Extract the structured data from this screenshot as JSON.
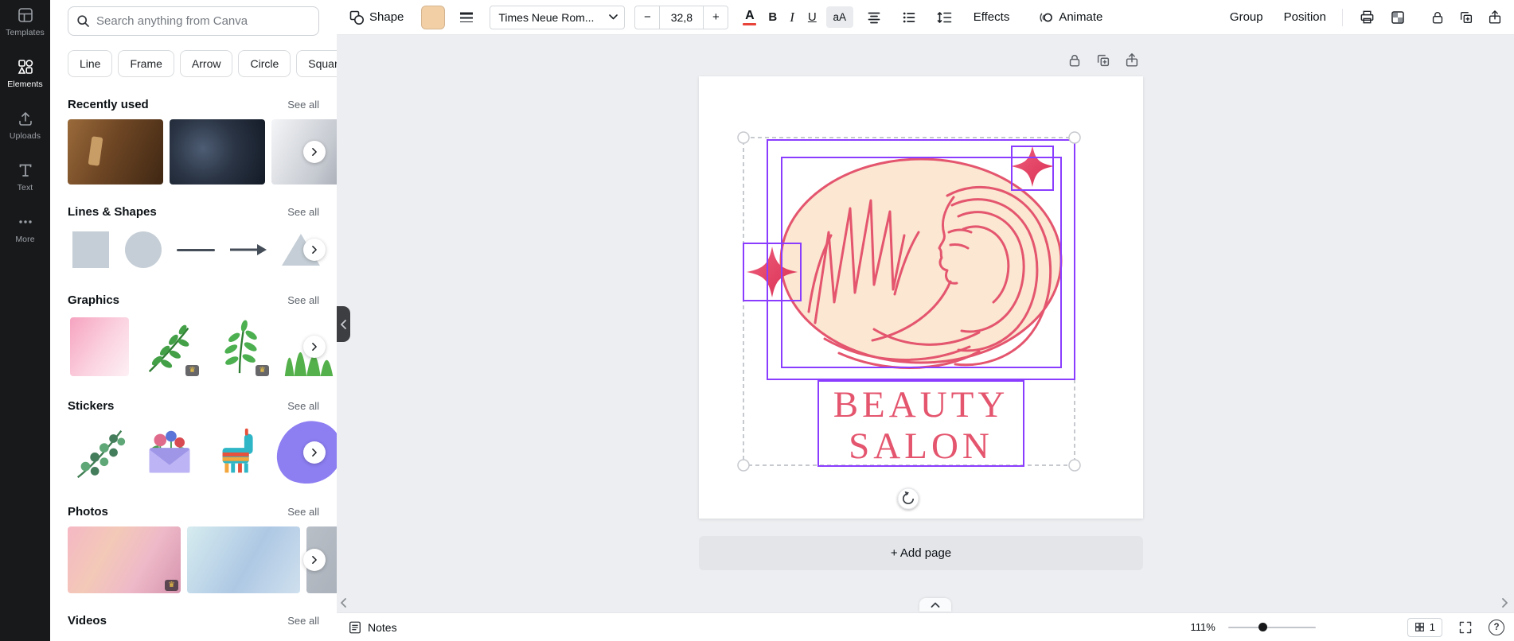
{
  "colors": {
    "purple_selection": "#8b3dff",
    "brand_pink": "#e4556e",
    "sparkle_red": "#d92e52",
    "cream_fill": "#fbe7d2",
    "toolbar_swatch": "#f2cfa5",
    "font_color_indicator": "#e8443a",
    "canvas_background": "#eceef1",
    "rail_background": "#18191b"
  },
  "rail": {
    "items": [
      {
        "label": "Templates"
      },
      {
        "label": "Elements"
      },
      {
        "label": "Uploads"
      },
      {
        "label": "Text"
      },
      {
        "label": "More"
      }
    ]
  },
  "panel": {
    "search": {
      "placeholder": "Search anything from Canva"
    },
    "chips": [
      "Line",
      "Frame",
      "Arrow",
      "Circle",
      "Square"
    ],
    "sections": {
      "recently_used": {
        "title": "Recently used",
        "see_all": "See all"
      },
      "lines_shapes": {
        "title": "Lines & Shapes",
        "see_all": "See all"
      },
      "graphics": {
        "title": "Graphics",
        "see_all": "See all"
      },
      "stickers": {
        "title": "Stickers",
        "see_all": "See all"
      },
      "photos": {
        "title": "Photos",
        "see_all": "See all"
      },
      "videos": {
        "title": "Videos",
        "see_all": "See all"
      }
    }
  },
  "toolbar": {
    "shape_label": "Shape",
    "font_family": "Times Neue Rom...",
    "font_size": "32,8",
    "decrease_label": "−",
    "increase_label": "+",
    "color_button": "A",
    "bold_label": "B",
    "italic_label": "I",
    "underline_label": "U",
    "case_label": "aA",
    "effects_label": "Effects",
    "animate_label": "Animate",
    "group_label": "Group",
    "position_label": "Position"
  },
  "canvas": {
    "logo_line1": "BEAUTY",
    "logo_line2": "SALON",
    "add_page_label": "+ Add page"
  },
  "statusbar": {
    "notes_label": "Notes",
    "zoom_percent": "111%",
    "page_number": "1"
  },
  "icons": {
    "crown": "♛",
    "help": "?"
  }
}
